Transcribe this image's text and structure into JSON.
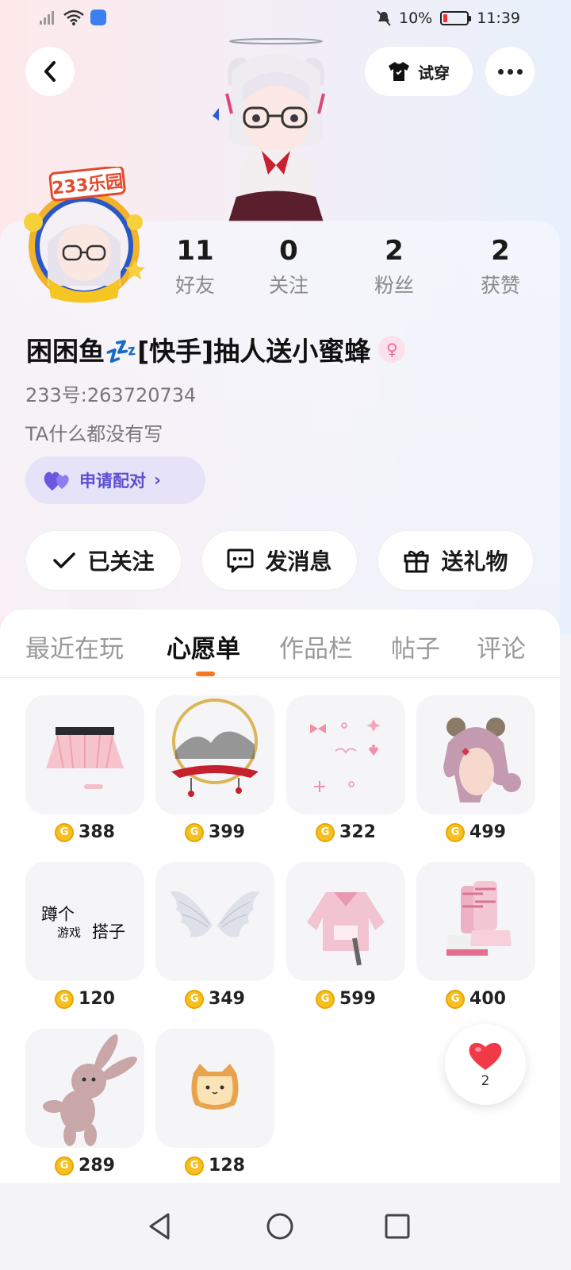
{
  "status_bar": {
    "battery_text": "10%",
    "time": "11:39"
  },
  "top_bar": {
    "tryon_label": "试穿"
  },
  "badge": {
    "logo_text": "233乐园"
  },
  "stats": [
    {
      "value": "11",
      "label": "好友"
    },
    {
      "value": "0",
      "label": "关注"
    },
    {
      "value": "2",
      "label": "粉丝"
    },
    {
      "value": "2",
      "label": "获赞"
    }
  ],
  "profile": {
    "name": "困困鱼💤[快手]抽人送小蜜蜂",
    "uid": "233号:263720734",
    "bio": "TA什么都没有写",
    "pair_label": "申请配对"
  },
  "actions": {
    "follow": "已关注",
    "message": "发消息",
    "gift": "送礼物"
  },
  "tabs": [
    "最近在玩",
    "心愿单",
    "作品栏",
    "帖子",
    "评论"
  ],
  "active_tab": "心愿单",
  "wishlist": [
    {
      "name": "pink-skirt",
      "price": "388"
    },
    {
      "name": "ink-landscape-halo",
      "price": "399"
    },
    {
      "name": "cute-stickers",
      "price": "322"
    },
    {
      "name": "bun-hairstyle",
      "price": "499"
    },
    {
      "name": "text-sticker",
      "price": "120",
      "text_line1": "蹲个",
      "text_line2": "游戏",
      "text_line3": "搭子"
    },
    {
      "name": "white-wings",
      "price": "349"
    },
    {
      "name": "pink-jacket",
      "price": "599"
    },
    {
      "name": "pink-boots",
      "price": "400"
    },
    {
      "name": "bunny-plush",
      "price": "289"
    },
    {
      "name": "cat-bread",
      "price": "128"
    }
  ],
  "like_float": {
    "count": "2"
  },
  "colors": {
    "accent": "#f7781e",
    "pair_purple": "#5a4fd0",
    "coin": "#f6c020"
  }
}
